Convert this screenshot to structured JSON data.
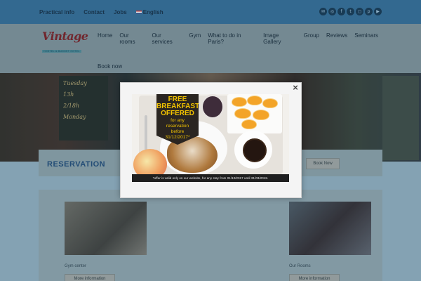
{
  "topbar": {
    "links": [
      "Practical info",
      "Contact",
      "Jobs"
    ],
    "language": "English",
    "social_icons": [
      "email-icon",
      "tripadvisor-icon",
      "facebook-icon",
      "twitter-icon",
      "instagram-icon",
      "pinterest-icon",
      "youtube-icon"
    ]
  },
  "header": {
    "logo_word": "Vintage",
    "logo_tag": "HOSTEL & BUDGET HOTEL",
    "nav": [
      "Home",
      "Our rooms",
      "Our services",
      "Gym",
      "What to do in Paris?",
      "Image Gallery",
      "Group",
      "Reviews",
      "Seminars"
    ],
    "nav_row2": "Book now"
  },
  "hero": {
    "board_lines": [
      "Tuesday",
      "13h",
      "2/18h",
      "Monday"
    ]
  },
  "reservation": {
    "title": "RESERVATION",
    "button": "Book Now"
  },
  "cards": [
    {
      "caption": "Gym center",
      "button": "More information"
    },
    {
      "caption": "Our Rooms",
      "button": "More information"
    }
  ],
  "modal": {
    "close_label": "×",
    "banner_line1": "FREE",
    "banner_line2": "BREAKFAST",
    "banner_line3": "OFFERED",
    "banner_line4": "for any",
    "banner_line5": "reservation",
    "banner_line6": "before",
    "banner_line7": "31/12/2017*",
    "fine_print": "*offer is valid only on our website, for any stay from 01/10/2017 until 31/03/2018."
  }
}
